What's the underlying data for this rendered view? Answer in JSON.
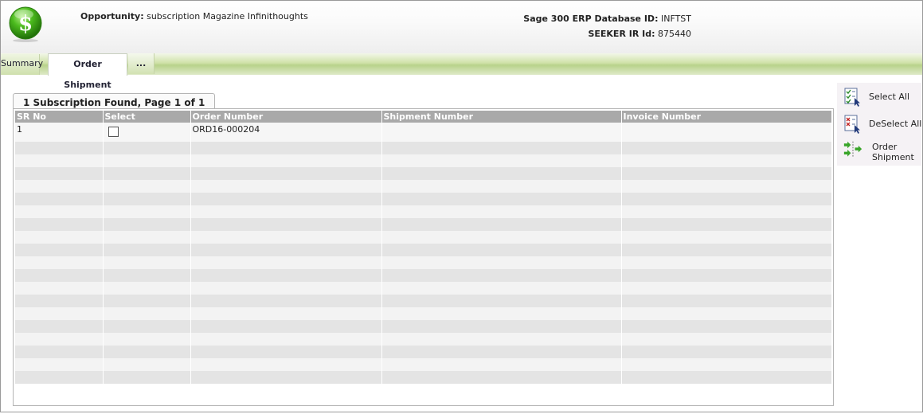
{
  "header": {
    "opportunity_label": "Opportunity:",
    "opportunity_value": "subscription Magazine Infinithoughts",
    "db_label": "Sage 300 ERP Database ID:",
    "db_value": "INFTST",
    "seeker_label": "SEEKER IR Id:",
    "seeker_value": "875440"
  },
  "tabs": [
    {
      "label": "Summary"
    },
    {
      "label": "Order Shipment"
    },
    {
      "label": "..."
    }
  ],
  "grid": {
    "caption": "1 Subscription Found, Page 1 of 1",
    "columns": [
      "SR No",
      "Select",
      "Order Number",
      "Shipment Number",
      "Invoice Number"
    ],
    "rows": [
      {
        "sr_no": "1",
        "selected": false,
        "order_number": "ORD16-000204",
        "shipment_number": "",
        "invoice_number": ""
      }
    ]
  },
  "actions": {
    "select_all": "Select All",
    "deselect_all": "DeSelect All",
    "order_shipment": "Order Shipment"
  },
  "colors": {
    "accent_green": "#b8d28a",
    "header_gray": "#a9a9a9",
    "logo_green": "#3fae1a"
  }
}
